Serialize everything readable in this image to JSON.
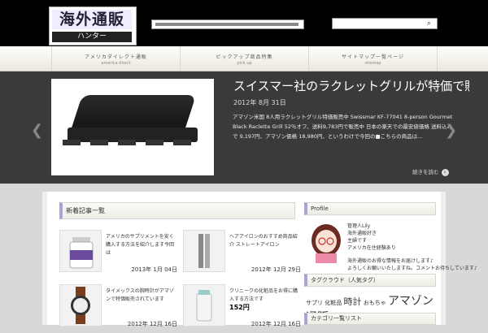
{
  "header": {
    "logo_main": "海外通販",
    "logo_sub": "ハンター",
    "search": {
      "placeholder": "",
      "value": ""
    }
  },
  "nav": {
    "items": [
      {
        "jp": "アメリカダイレクト通販",
        "en": "america direct"
      },
      {
        "jp": "ピックアップ商品特集",
        "en": "pick up"
      },
      {
        "jp": "サイトマップ一覧ページ",
        "en": "sitemap"
      }
    ]
  },
  "slider": {
    "title": "スイスマー社のラクレットグリルが特価で販売中です",
    "date": "2012年 8月 31日",
    "body": "アマゾン米国 8人用ラクレットグリル特価販売中 Swissmar KF-77041 8-person Gourmet Black Raclette Grill 52％オフ、送料9,783円で販売中 日本の楽天での最安値価格 送料込みで 9,197円、アマゾン価格 18,980円、というわけで今回の■こちらの商品は...",
    "more_label": "続きを読む"
  },
  "main": {
    "section_title": "新着記事一覧",
    "posts": [
      {
        "title": "アメリカのサプリメントを安く購入する方法を紹介します今回は",
        "date": "2013年 1月 04日"
      },
      {
        "title": "ヘアアイロンのおすすめ商品紹介 ストレートアイロン",
        "date": "2012年 12月 29日"
      },
      {
        "title": "タイメックスの腕時計がアマゾンで特価販売されています",
        "date": "2012年 12月 16日"
      },
      {
        "title": "クリニークの化粧品をお得に購入する方法です",
        "price": "152円",
        "date": "2012年 12月 16日"
      }
    ]
  },
  "sidebar": {
    "profile_title": "Profile",
    "profile_lines": [
      "管理人Lily",
      "海外通販好き",
      "主婦です",
      "アメリカ在住経験あり",
      "",
      "海外通販のお得な情報をお届けします♪",
      "よろしくお願いいたしますね。コメントお待ちしています♪"
    ],
    "tags_title": "タグクラウド（人気タグ）",
    "tags": [
      {
        "label": "サプリ 化粧品",
        "size": 1
      },
      {
        "label": "時計",
        "size": 2
      },
      {
        "label": "おもちゃ",
        "size": 1
      },
      {
        "label": "アマゾン通販",
        "size": 3
      }
    ],
    "category_title": "カテゴリ一覧リスト"
  }
}
